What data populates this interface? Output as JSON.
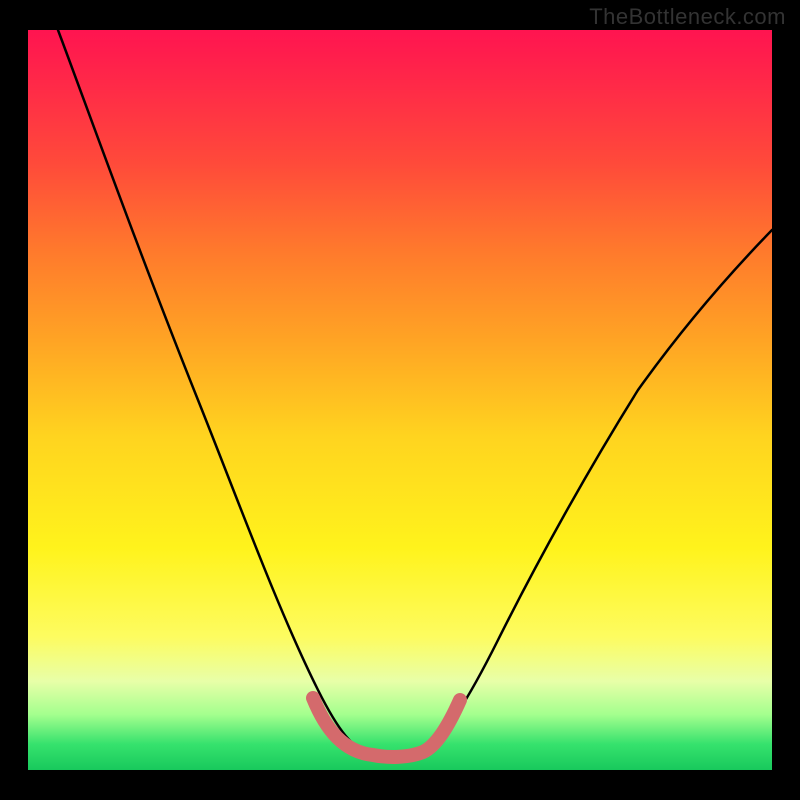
{
  "watermark": "TheBottleneck.com",
  "chart_data": {
    "type": "line",
    "title": "",
    "xlabel": "",
    "ylabel": "",
    "xlim": [
      0,
      100
    ],
    "ylim": [
      0,
      100
    ],
    "series": [
      {
        "name": "curve",
        "x": [
          4,
          10,
          15,
          20,
          25,
          30,
          33,
          36,
          38,
          40,
          44,
          48,
          50,
          52,
          55,
          60,
          65,
          70,
          75,
          80,
          85,
          90,
          95,
          100
        ],
        "y": [
          100,
          86,
          75,
          63,
          51,
          38,
          30,
          22,
          15,
          9,
          3,
          2,
          2,
          3,
          7,
          15,
          23,
          31,
          38,
          44,
          50,
          56,
          61,
          66
        ],
        "stroke": "#000000"
      },
      {
        "name": "highlight",
        "x": [
          38,
          40,
          44,
          48,
          50,
          52,
          55
        ],
        "y": [
          9,
          4,
          2,
          2,
          2,
          3,
          7
        ],
        "stroke": "#d46a6c"
      }
    ],
    "gradient_stops": [
      {
        "pos": 0,
        "color": "#ff1450"
      },
      {
        "pos": 0.18,
        "color": "#ff4a3a"
      },
      {
        "pos": 0.42,
        "color": "#ffa424"
      },
      {
        "pos": 0.7,
        "color": "#fff31c"
      },
      {
        "pos": 0.92,
        "color": "#a4ff8e"
      },
      {
        "pos": 1.0,
        "color": "#18c95c"
      }
    ]
  }
}
